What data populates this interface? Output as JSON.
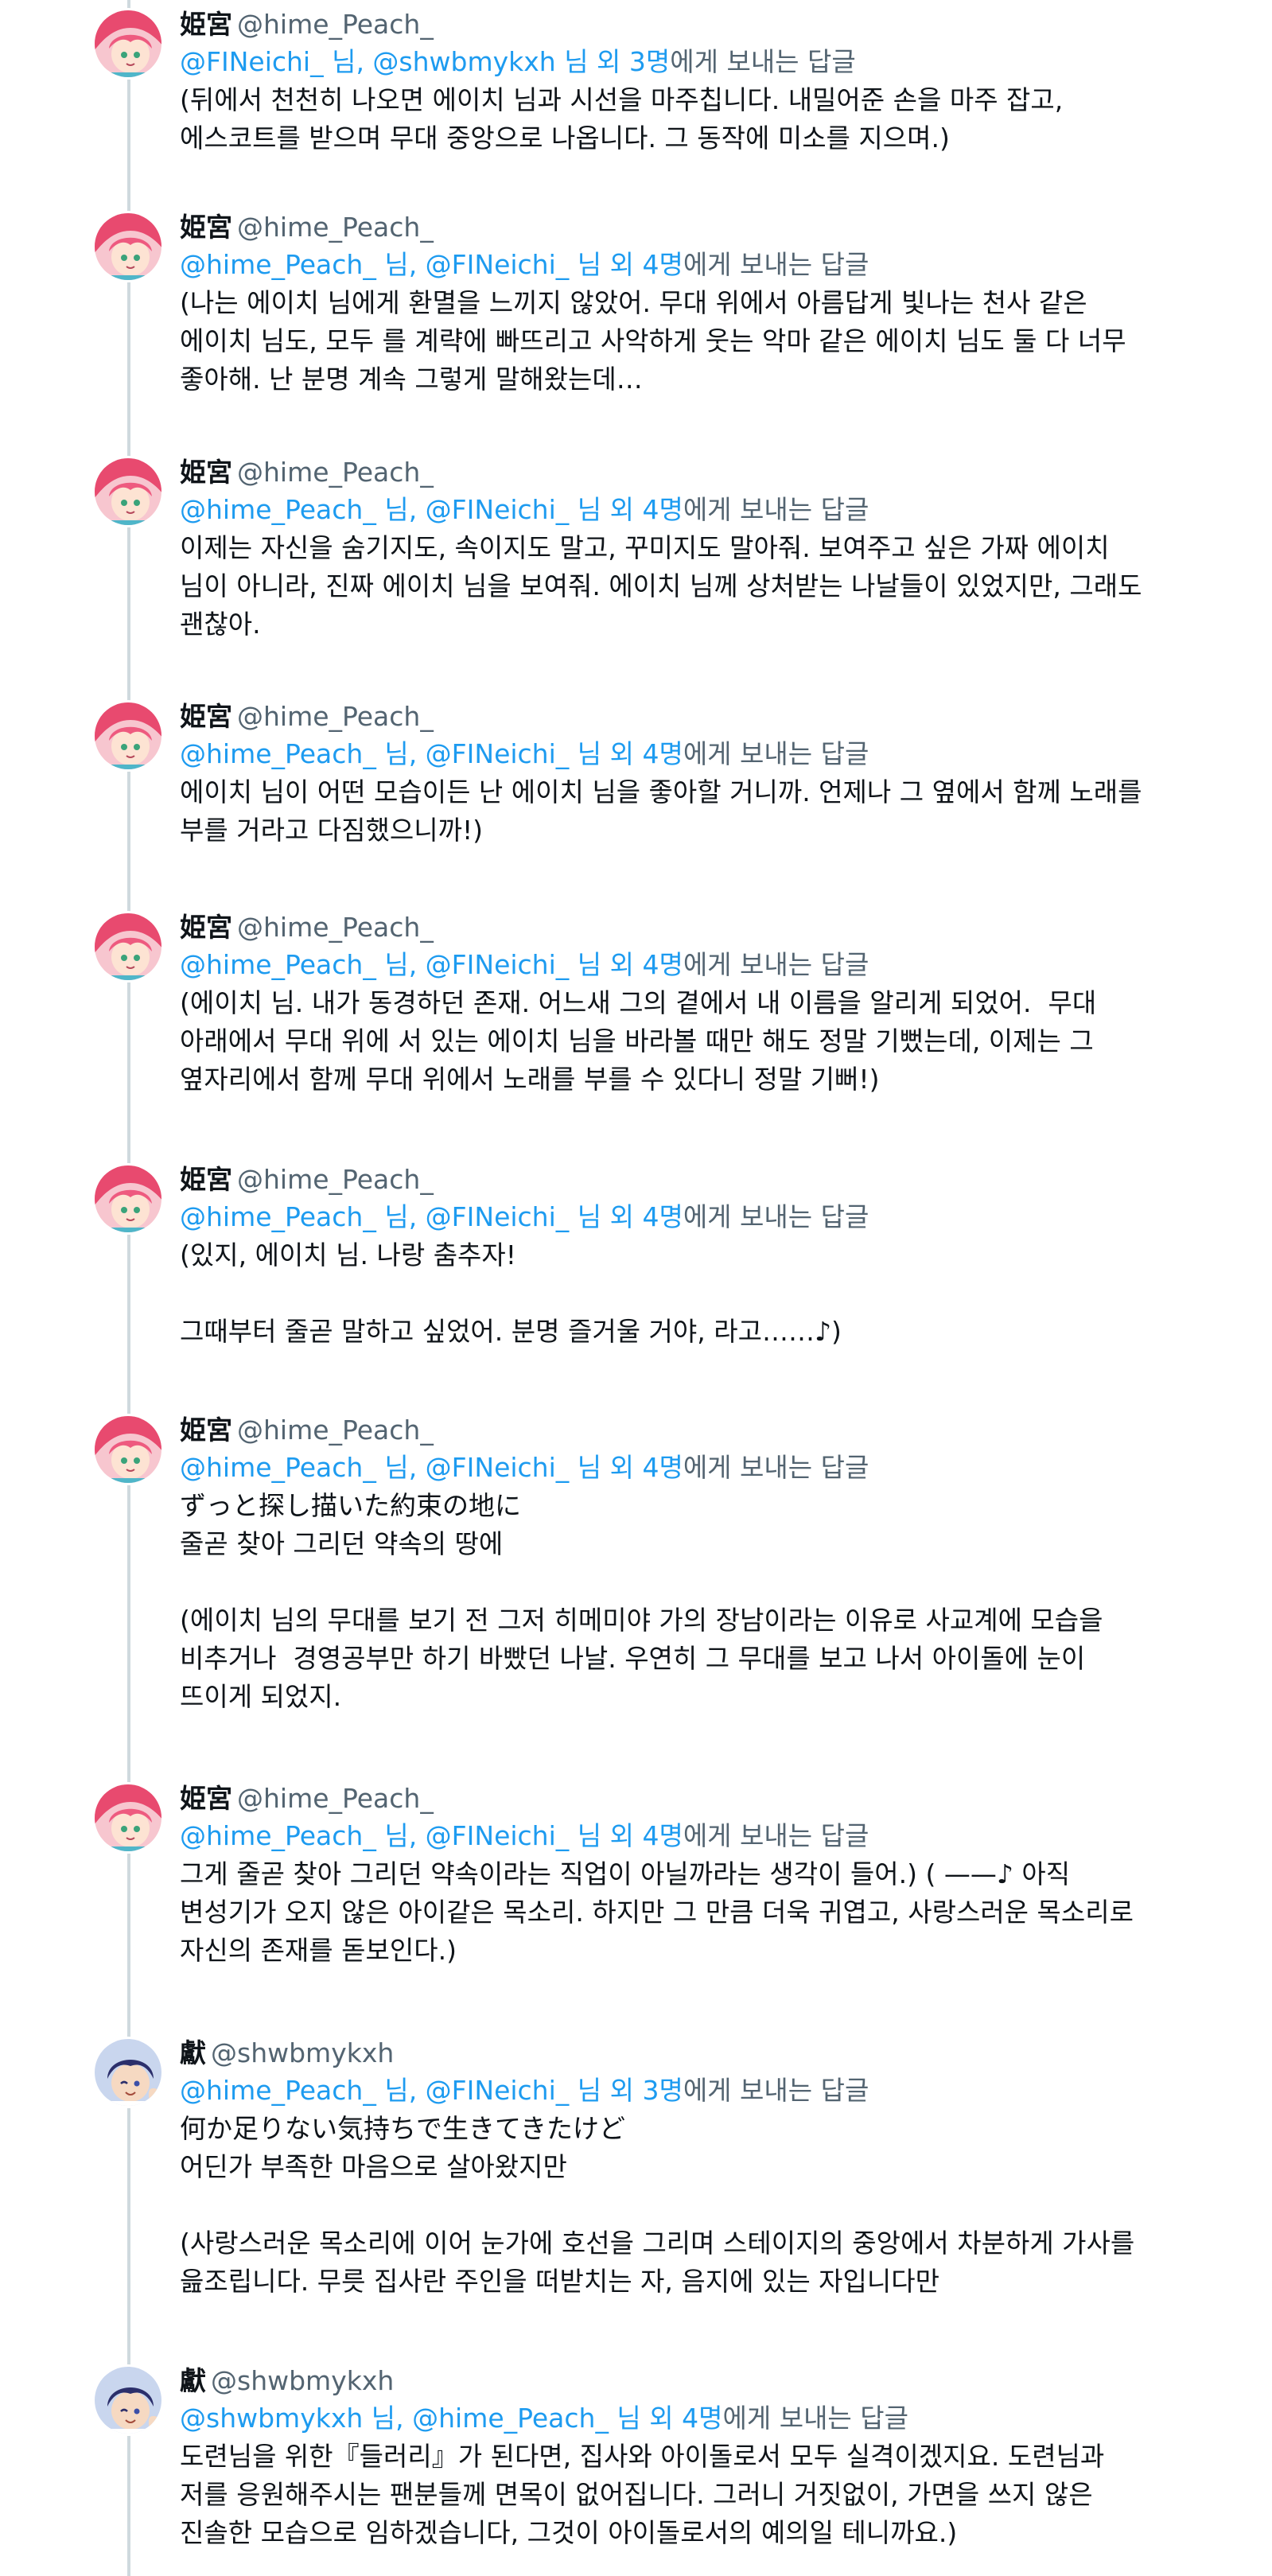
{
  "colors": {
    "link": "#1d9bf0",
    "muted": "#536471",
    "text": "#0f1419",
    "thread_line": "#cfd9de"
  },
  "tweets": [
    {
      "avatar": "pink-haired-avatar",
      "display_name": "姫宮",
      "handle": "@hime_Peach_",
      "reply_mentions": "@FINeichi_ 님, @shwbmykxh 님 외 3명",
      "reply_suffix": "에게 보내는 답글",
      "body": "(뒤에서 천천히 나오면 에이치 님과 시선을 마주칩니다. 내밀어준 손을 마주 잡고,\n에스코트를 받으며 무대 중앙으로 나옵니다. 그 동작에 미소를 지으며.)"
    },
    {
      "avatar": "pink-haired-avatar",
      "display_name": "姫宮",
      "handle": "@hime_Peach_",
      "reply_mentions": "@hime_Peach_ 님, @FINeichi_ 님 외 4명",
      "reply_suffix": "에게 보내는 답글",
      "body": "(나는 에이치 님에게 환멸을 느끼지 않았어. 무대 위에서 아름답게 빛나는 천사 같은\n에이치 님도, 모두 를 계략에 빠뜨리고 사악하게 웃는 악마 같은 에이치 님도 둘 다 너무\n좋아해. 난 분명 계속 그렇게 말해왔는데…"
    },
    {
      "avatar": "pink-haired-avatar",
      "display_name": "姫宮",
      "handle": "@hime_Peach_",
      "reply_mentions": "@hime_Peach_ 님, @FINeichi_ 님 외 4명",
      "reply_suffix": "에게 보내는 답글",
      "body": "이제는 자신을 숨기지도, 속이지도 말고, 꾸미지도 말아줘. 보여주고 싶은 가짜 에이치\n님이 아니라, 진짜 에이치 님을 보여줘. 에이치 님께 상처받는 나날들이 있었지만, 그래도\n괜찮아."
    },
    {
      "avatar": "pink-haired-avatar",
      "display_name": "姫宮",
      "handle": "@hime_Peach_",
      "reply_mentions": "@hime_Peach_ 님, @FINeichi_ 님 외 4명",
      "reply_suffix": "에게 보내는 답글",
      "body": "에이치 님이 어떤 모습이든 난 에이치 님을 좋아할 거니까. 언제나 그 옆에서 함께 노래를\n부를 거라고 다짐했으니까!)"
    },
    {
      "avatar": "pink-haired-avatar",
      "display_name": "姫宮",
      "handle": "@hime_Peach_",
      "reply_mentions": "@hime_Peach_ 님, @FINeichi_ 님 외 4명",
      "reply_suffix": "에게 보내는 답글",
      "body": "(에이치 님. 내가 동경하던 존재. 어느새 그의 곁에서 내 이름을 알리게 되었어.  무대\n아래에서 무대 위에 서 있는 에이치 님을 바라볼 때만 해도 정말 기뻤는데, 이제는 그\n옆자리에서 함께 무대 위에서 노래를 부를 수 있다니 정말 기뻐!)"
    },
    {
      "avatar": "pink-haired-avatar",
      "display_name": "姫宮",
      "handle": "@hime_Peach_",
      "reply_mentions": "@hime_Peach_ 님, @FINeichi_ 님 외 4명",
      "reply_suffix": "에게 보내는 답글",
      "body": "(있지, 에이치 님. 나랑 춤추자!\n\n그때부터 줄곧 말하고 싶었어. 분명 즐거울 거야, 라고……♪)"
    },
    {
      "avatar": "pink-haired-avatar",
      "display_name": "姫宮",
      "handle": "@hime_Peach_",
      "reply_mentions": "@hime_Peach_ 님, @FINeichi_ 님 외 4명",
      "reply_suffix": "에게 보내는 답글",
      "body": "ずっと探し描いた約束の地に\n줄곧 찾아 그리던 약속의 땅에\n\n(에이치 님의 무대를 보기 전 그저 히메미야 가의 장남이라는 이유로 사교계에 모습을\n비추거나  경영공부만 하기 바빴던 나날. 우연히 그 무대를 보고 나서 아이돌에 눈이\n뜨이게 되었지."
    },
    {
      "avatar": "pink-haired-avatar",
      "display_name": "姫宮",
      "handle": "@hime_Peach_",
      "reply_mentions": "@hime_Peach_ 님, @FINeichi_ 님 외 4명",
      "reply_suffix": "에게 보내는 답글",
      "body": "그게 줄곧 찾아 그리던 약속이라는 직업이 아닐까라는 생각이 들어.) ( ——♪ 아직\n변성기가 오지 않은 아이같은 목소리. 하지만 그 만큼 더욱 귀엽고, 사랑스러운 목소리로\n자신의 존재를 돋보인다.)"
    },
    {
      "avatar": "dark-haired-avatar",
      "display_name": "獻",
      "handle": "@shwbmykxh",
      "reply_mentions": "@hime_Peach_ 님, @FINeichi_ 님 외 3명",
      "reply_suffix": "에게 보내는 답글",
      "body": "何か足りない気持ちで生きてきたけど\n어딘가 부족한 마음으로 살아왔지만\n\n(사랑스러운 목소리에 이어 눈가에 호선을 그리며 스테이지의 중앙에서 차분하게 가사를\n읊조립니다. 무릇 집사란 주인을 떠받치는 자, 음지에 있는 자입니다만"
    },
    {
      "avatar": "dark-haired-avatar",
      "display_name": "獻",
      "handle": "@shwbmykxh",
      "reply_mentions": "@shwbmykxh 님, @hime_Peach_ 님 외 4명",
      "reply_suffix": "에게 보내는 답글",
      "body": "도련님을 위한『들러리』가 된다면, 집사와 아이돌로서 모두 실격이겠지요. 도련님과\n저를 응원해주시는 팬분들께 면목이 없어집니다. 그러니 거짓없이, 가면을 쓰지 않은\n진솔한 모습으로 임하겠습니다, 그것이 아이돌로서의 예의일 테니까요.)"
    }
  ]
}
